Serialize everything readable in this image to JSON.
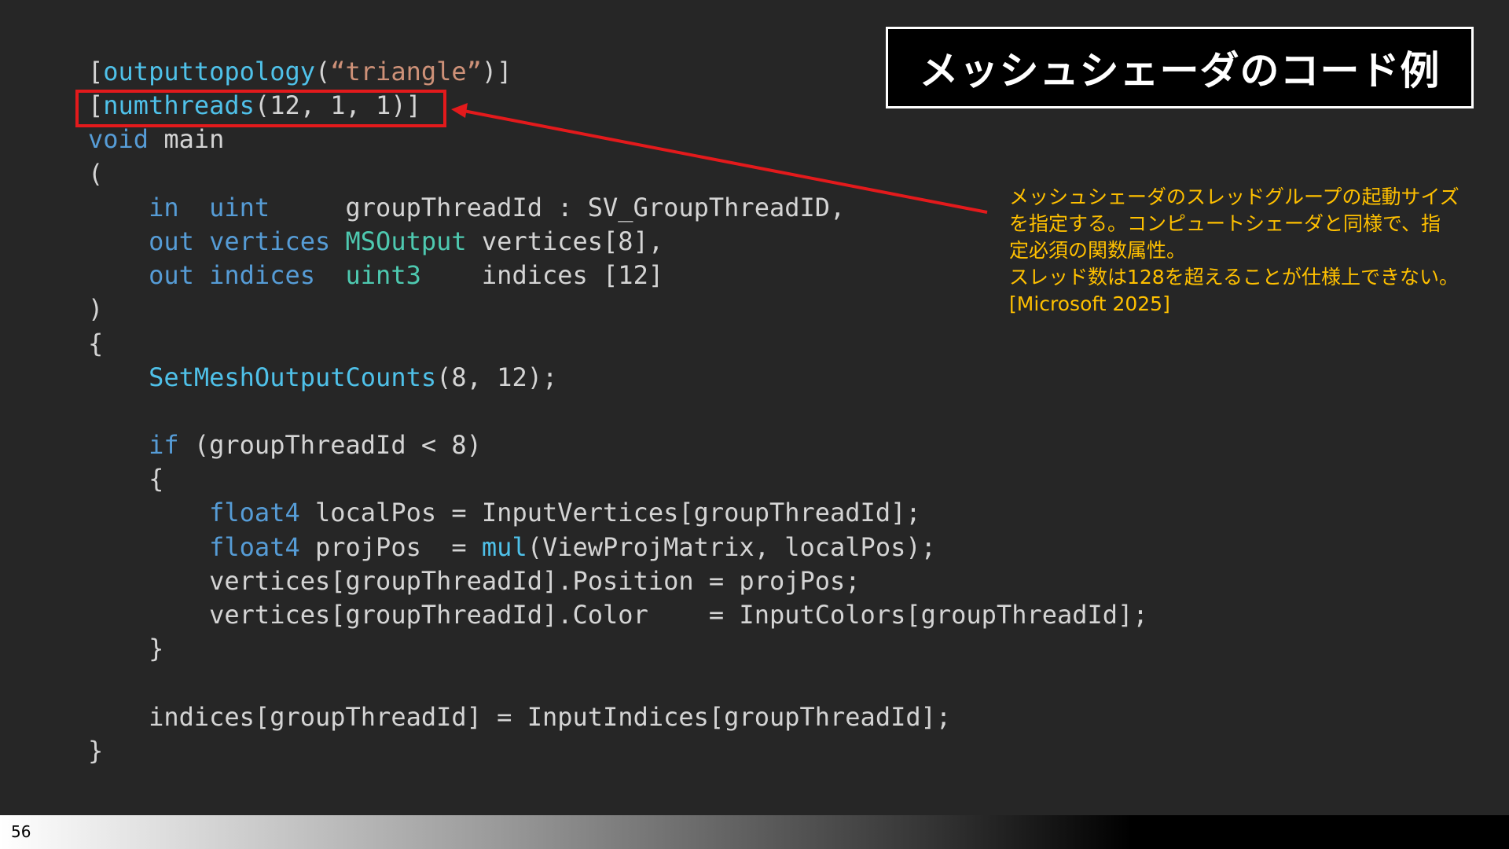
{
  "code": {
    "lines": [
      [
        {
          "t": "[",
          "c": "plain"
        },
        {
          "t": "outputtopology",
          "c": "fn"
        },
        {
          "t": "(",
          "c": "plain"
        },
        {
          "t": "“triangle”",
          "c": "str"
        },
        {
          "t": ")]",
          "c": "plain"
        }
      ],
      [
        {
          "t": "[",
          "c": "plain"
        },
        {
          "t": "numthreads",
          "c": "fn"
        },
        {
          "t": "(12, 1, 1)]",
          "c": "plain"
        }
      ],
      [
        {
          "t": "void",
          "c": "blue"
        },
        {
          "t": " main",
          "c": "plain"
        }
      ],
      [
        {
          "t": "(",
          "c": "plain"
        }
      ],
      [
        {
          "t": "    ",
          "c": "plain"
        },
        {
          "t": "in",
          "c": "blue"
        },
        {
          "t": "  ",
          "c": "plain"
        },
        {
          "t": "uint",
          "c": "blue"
        },
        {
          "t": "     groupThreadId : SV_GroupThreadID,",
          "c": "plain"
        }
      ],
      [
        {
          "t": "    ",
          "c": "plain"
        },
        {
          "t": "out",
          "c": "blue"
        },
        {
          "t": " ",
          "c": "plain"
        },
        {
          "t": "vertices",
          "c": "blue"
        },
        {
          "t": " ",
          "c": "plain"
        },
        {
          "t": "MSOutput",
          "c": "type"
        },
        {
          "t": " vertices[8],",
          "c": "plain"
        }
      ],
      [
        {
          "t": "    ",
          "c": "plain"
        },
        {
          "t": "out",
          "c": "blue"
        },
        {
          "t": " ",
          "c": "plain"
        },
        {
          "t": "indices",
          "c": "blue"
        },
        {
          "t": "  ",
          "c": "plain"
        },
        {
          "t": "uint3",
          "c": "type"
        },
        {
          "t": "    indices [12]",
          "c": "plain"
        }
      ],
      [
        {
          "t": ")",
          "c": "plain"
        }
      ],
      [
        {
          "t": "{",
          "c": "plain"
        }
      ],
      [
        {
          "t": "    ",
          "c": "plain"
        },
        {
          "t": "SetMeshOutputCounts",
          "c": "fn"
        },
        {
          "t": "(8, 12);",
          "c": "plain"
        }
      ],
      [],
      [
        {
          "t": "    ",
          "c": "plain"
        },
        {
          "t": "if",
          "c": "blue"
        },
        {
          "t": " (groupThreadId < 8)",
          "c": "plain"
        }
      ],
      [
        {
          "t": "    {",
          "c": "plain"
        }
      ],
      [
        {
          "t": "        ",
          "c": "plain"
        },
        {
          "t": "float4",
          "c": "blue"
        },
        {
          "t": " localPos = InputVertices[groupThreadId];",
          "c": "plain"
        }
      ],
      [
        {
          "t": "        ",
          "c": "plain"
        },
        {
          "t": "float4",
          "c": "blue"
        },
        {
          "t": " projPos  = ",
          "c": "plain"
        },
        {
          "t": "mul",
          "c": "fn"
        },
        {
          "t": "(ViewProjMatrix, localPos);",
          "c": "plain"
        }
      ],
      [
        {
          "t": "        vertices[groupThreadId].Position = projPos;",
          "c": "plain"
        }
      ],
      [
        {
          "t": "        vertices[groupThreadId].Color    = InputColors[groupThreadId];",
          "c": "plain"
        }
      ],
      [
        {
          "t": "    }",
          "c": "plain"
        }
      ],
      [],
      [
        {
          "t": "    indices[groupThreadId] = InputIndices[groupThreadId];",
          "c": "plain"
        }
      ],
      [
        {
          "t": "}",
          "c": "plain"
        }
      ]
    ]
  },
  "title": "メッシュシェーダのコード例",
  "note": {
    "lines": [
      "メッシュシェーダのスレッドグループの起動サイズ",
      "を指定する。コンピュートシェーダと同様で、指",
      "定必須の関数属性。",
      "スレッド数は128を超えることが仕様上できない。",
      "[Microsoft 2025]"
    ]
  },
  "page_number": "56",
  "colors": {
    "background": "#262626",
    "keyword": "#569cd6",
    "function": "#4fc1e9",
    "string": "#ce9178",
    "type": "#4ec9b0",
    "highlight": "#e31a1c",
    "note": "#ffc000"
  }
}
